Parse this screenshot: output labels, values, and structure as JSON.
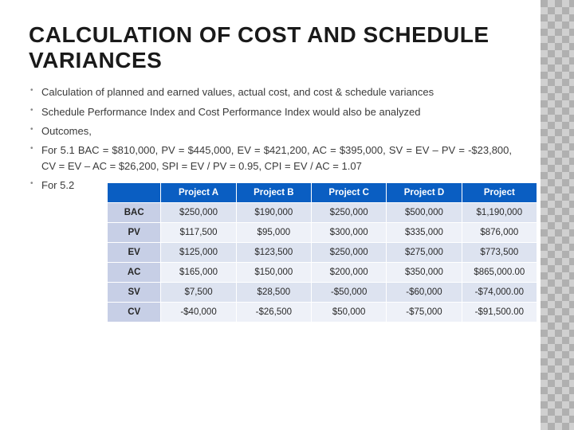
{
  "title": "CALCULATION OF COST AND SCHEDULE VARIANCES",
  "bullets": [
    "Calculation of planned and earned values, actual cost, and cost & schedule variances",
    "Schedule Performance Index and Cost Performance Index would also be analyzed",
    "Outcomes,",
    "For 5.1 BAC = $810,000, PV = $445,000, EV = $421,200, AC = $395,000, SV = EV – PV = -$23,800, CV = EV – AC = $26,200, SPI = EV / PV = 0.95, CPI = EV / AC = 1.07",
    "For 5.2"
  ],
  "table": {
    "headers": [
      "",
      "Project A",
      "Project B",
      "Project C",
      "Project D",
      "Project"
    ],
    "rows": [
      {
        "label": "BAC",
        "cells": [
          "$250,000",
          "$190,000",
          "$250,000",
          "$500,000",
          "$1,190,000"
        ]
      },
      {
        "label": "PV",
        "cells": [
          "$117,500",
          "$95,000",
          "$300,000",
          "$335,000",
          "$876,000"
        ]
      },
      {
        "label": "EV",
        "cells": [
          "$125,000",
          "$123,500",
          "$250,000",
          "$275,000",
          "$773,500"
        ]
      },
      {
        "label": "AC",
        "cells": [
          "$165,000",
          "$150,000",
          "$200,000",
          "$350,000",
          "$865,000.00"
        ]
      },
      {
        "label": "SV",
        "cells": [
          "$7,500",
          "$28,500",
          "-$50,000",
          "-$60,000",
          "-$74,000.00"
        ]
      },
      {
        "label": "CV",
        "cells": [
          "-$40,000",
          "-$26,500",
          "$50,000",
          "-$75,000",
          "-$91,500.00"
        ]
      }
    ]
  }
}
